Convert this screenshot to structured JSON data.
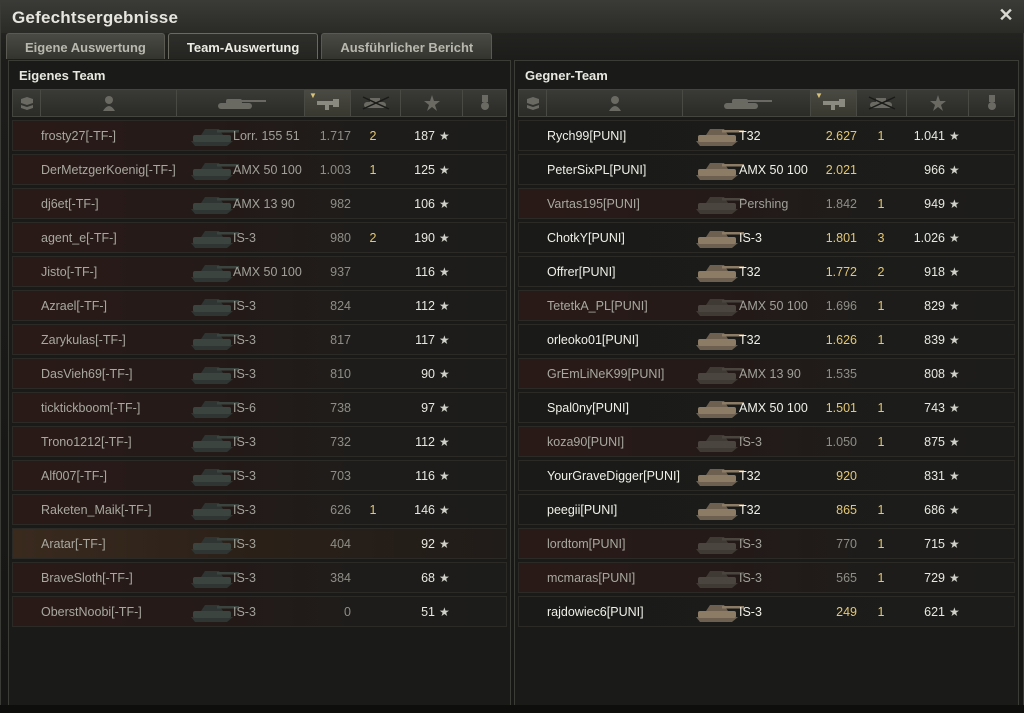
{
  "window": {
    "title": "Gefechtsergebnisse"
  },
  "tabs": [
    {
      "label": "Eigene Auswertung"
    },
    {
      "label": "Team-Auswertung"
    },
    {
      "label": "Ausführlicher Bericht"
    }
  ],
  "left_team": {
    "title": "Eigenes Team",
    "players": [
      {
        "name": "frosty27[-TF-]",
        "tank": "Lorr. 155 51",
        "damage": "1.717",
        "kills": "2",
        "xp": "187"
      },
      {
        "name": "DerMetzgerKoenig[-TF-]",
        "tank": "AMX 50 100",
        "damage": "1.003",
        "kills": "1",
        "xp": "125"
      },
      {
        "name": "dj6et[-TF-]",
        "tank": "AMX 13 90",
        "damage": "982",
        "kills": "",
        "xp": "106"
      },
      {
        "name": "agent_e[-TF-]",
        "tank": "IS-3",
        "damage": "980",
        "kills": "2",
        "xp": "190"
      },
      {
        "name": "Jisto[-TF-]",
        "tank": "AMX 50 100",
        "damage": "937",
        "kills": "",
        "xp": "116"
      },
      {
        "name": "Azrael[-TF-]",
        "tank": "IS-3",
        "damage": "824",
        "kills": "",
        "xp": "112"
      },
      {
        "name": "Zarykulas[-TF-]",
        "tank": "IS-3",
        "damage": "817",
        "kills": "",
        "xp": "117"
      },
      {
        "name": "DasVieh69[-TF-]",
        "tank": "IS-3",
        "damage": "810",
        "kills": "",
        "xp": "90"
      },
      {
        "name": "ticktickboom[-TF-]",
        "tank": "IS-6",
        "damage": "738",
        "kills": "",
        "xp": "97"
      },
      {
        "name": "Trono1212[-TF-]",
        "tank": "IS-3",
        "damage": "732",
        "kills": "",
        "xp": "112"
      },
      {
        "name": "Alf007[-TF-]",
        "tank": "IS-3",
        "damage": "703",
        "kills": "",
        "xp": "116"
      },
      {
        "name": "Raketen_Maik[-TF-]",
        "tank": "IS-3",
        "damage": "626",
        "kills": "1",
        "xp": "146"
      },
      {
        "name": "Aratar[-TF-]",
        "tank": "IS-3",
        "damage": "404",
        "kills": "",
        "xp": "92",
        "highlight": true
      },
      {
        "name": "BraveSloth[-TF-]",
        "tank": "IS-3",
        "damage": "384",
        "kills": "",
        "xp": "68"
      },
      {
        "name": "OberstNoobi[-TF-]",
        "tank": "IS-3",
        "damage": "0",
        "kills": "",
        "xp": "51"
      }
    ]
  },
  "right_team": {
    "title": "Gegner-Team",
    "players": [
      {
        "name": "Rych99[PUNI]",
        "tank": "T32",
        "damage": "2.627",
        "kills": "1",
        "xp": "1.041",
        "alive": true
      },
      {
        "name": "PeterSixPL[PUNI]",
        "tank": "AMX 50 100",
        "damage": "2.021",
        "kills": "",
        "xp": "966",
        "alive": true
      },
      {
        "name": "Vartas195[PUNI]",
        "tank": "Pershing",
        "damage": "1.842",
        "kills": "1",
        "xp": "949"
      },
      {
        "name": "ChotkY[PUNI]",
        "tank": "IS-3",
        "damage": "1.801",
        "kills": "3",
        "xp": "1.026",
        "alive": true
      },
      {
        "name": "Offrer[PUNI]",
        "tank": "T32",
        "damage": "1.772",
        "kills": "2",
        "xp": "918",
        "alive": true
      },
      {
        "name": "TetetkA_PL[PUNI]",
        "tank": "AMX 50 100",
        "damage": "1.696",
        "kills": "1",
        "xp": "829"
      },
      {
        "name": "orleoko01[PUNI]",
        "tank": "T32",
        "damage": "1.626",
        "kills": "1",
        "xp": "839",
        "alive": true
      },
      {
        "name": "GrEmLiNeK99[PUNI]",
        "tank": "AMX 13 90",
        "damage": "1.535",
        "kills": "",
        "xp": "808"
      },
      {
        "name": "Spal0ny[PUNI]",
        "tank": "AMX 50 100",
        "damage": "1.501",
        "kills": "1",
        "xp": "743",
        "alive": true
      },
      {
        "name": "koza90[PUNI]",
        "tank": "IS-3",
        "damage": "1.050",
        "kills": "1",
        "xp": "875"
      },
      {
        "name": "YourGraveDigger[PUNI]",
        "tank": "T32",
        "damage": "920",
        "kills": "",
        "xp": "831",
        "alive": true
      },
      {
        "name": "peegii[PUNI]",
        "tank": "T32",
        "damage": "865",
        "kills": "1",
        "xp": "686",
        "alive": true
      },
      {
        "name": "lordtom[PUNI]",
        "tank": "IS-3",
        "damage": "770",
        "kills": "1",
        "xp": "715"
      },
      {
        "name": "mcmaras[PUNI]",
        "tank": "IS-3",
        "damage": "565",
        "kills": "1",
        "xp": "729"
      },
      {
        "name": "rajdowiec6[PUNI]",
        "tank": "IS-3",
        "damage": "249",
        "kills": "1",
        "xp": "621",
        "alive": true
      }
    ]
  },
  "icons": {
    "star": "★",
    "close": "✕",
    "column_icons": [
      "platoon-icon",
      "player-icon",
      "tank-icon",
      "damage-icon",
      "kills-icon",
      "xp-star-icon",
      "medal-icon"
    ]
  },
  "colors": {
    "accent_gold": "#e3c774",
    "dead_row": "#2a1a17",
    "highlight_row": "#3a2a1e"
  }
}
